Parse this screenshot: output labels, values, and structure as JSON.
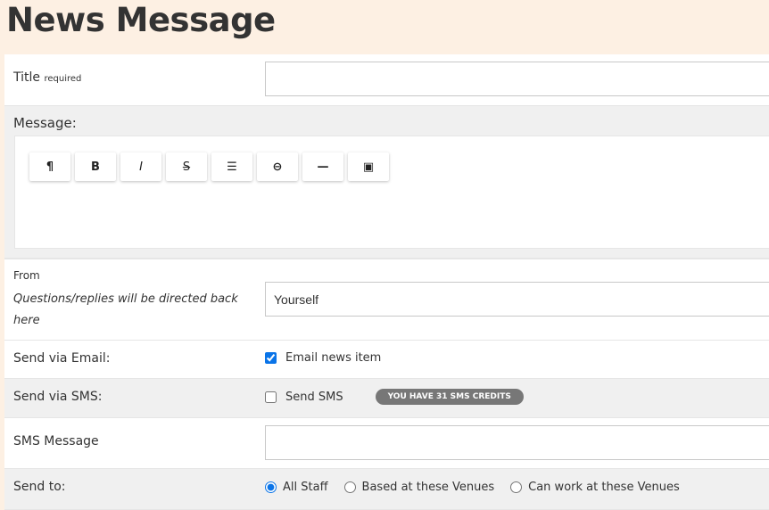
{
  "page": {
    "title": "News Message"
  },
  "form": {
    "title": {
      "label": "Title",
      "hint": "required",
      "value": ""
    },
    "message": {
      "label": "Message:",
      "toolbar": [
        {
          "icon": "paragraph-icon",
          "glyph": "¶"
        },
        {
          "icon": "bold-icon",
          "glyph": "B"
        },
        {
          "icon": "italic-icon",
          "glyph": "I"
        },
        {
          "icon": "strikethrough-icon",
          "glyph": "S"
        },
        {
          "icon": "bullet-list-icon",
          "glyph": "☰"
        },
        {
          "icon": "link-icon",
          "glyph": "⊖"
        },
        {
          "icon": "horizontal-rule-icon",
          "glyph": "—"
        },
        {
          "icon": "image-icon",
          "glyph": "▣"
        }
      ]
    },
    "from": {
      "label": "From",
      "hint": "Questions/replies will be directed back here",
      "value": "Yourself"
    },
    "email": {
      "label": "Send via Email:",
      "option": "Email news item",
      "checked": true
    },
    "sms": {
      "label": "Send via SMS:",
      "option": "Send SMS",
      "checked": false,
      "credits_badge": "YOU HAVE 31 SMS CREDITS"
    },
    "sms_message": {
      "label": "SMS Message",
      "value": ""
    },
    "send_to": {
      "label": "Send to:",
      "options": [
        "All Staff",
        "Based at these Venues",
        "Can work at these Venues"
      ],
      "selected": "All Staff"
    }
  }
}
